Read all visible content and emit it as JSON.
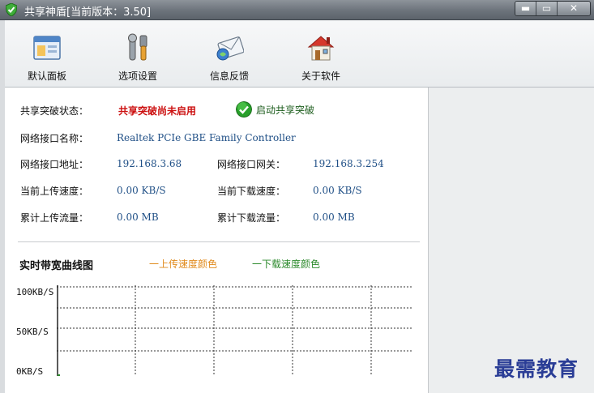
{
  "window": {
    "title": "共享神盾[当前版本：3.50]",
    "controls": [
      "minimize",
      "maximize",
      "close"
    ]
  },
  "toolbar": [
    {
      "label": "默认面板",
      "icon": "window-panel-icon"
    },
    {
      "label": "选项设置",
      "icon": "tools-icon"
    },
    {
      "label": "信息反馈",
      "icon": "mail-feedback-icon"
    },
    {
      "label": "关于软件",
      "icon": "home-icon"
    }
  ],
  "info": {
    "status_label": "共享突破状态：",
    "status_value": "共享突破尚未启用",
    "enable_label": "启动共享突破",
    "iface_name_label": "网络接口名称：",
    "iface_name_value": "Realtek PCIe GBE Family Controller",
    "iface_addr_label": "网络接口地址：",
    "iface_addr_value": "192.168.3.68",
    "gateway_label": "网络接口网关：",
    "gateway_value": "192.168.3.254",
    "up_speed_label": "当前上传速度：",
    "up_speed_value": "0.00 KB/S",
    "down_speed_label": "当前下载速度：",
    "down_speed_value": "0.00 KB/S",
    "up_total_label": "累计上传流量：",
    "up_total_value": "0.00 MB",
    "down_total_label": "累计下载流量：",
    "down_total_value": "0.00 MB"
  },
  "bandwidth": {
    "title": "实时带宽曲线图",
    "legend_up": "一上传速度颜色",
    "legend_down": "一下载速度颜色",
    "axis_top": "100KB/S",
    "axis_mid": "50KB/S",
    "axis_bottom": "0KB/S",
    "up_color": "#e08a1c",
    "down_color": "#2c8a2c"
  },
  "watermark": "最需教育"
}
